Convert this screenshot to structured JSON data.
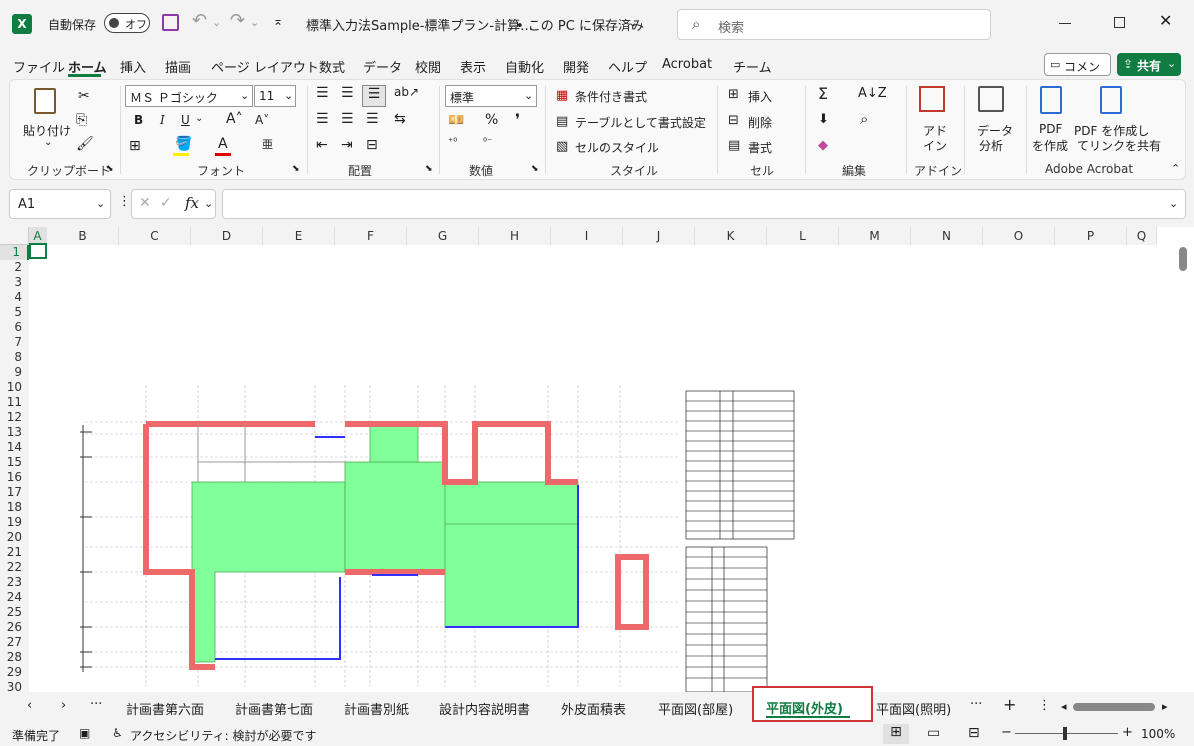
{
  "titlebar": {
    "autosave_label": "自動保存",
    "autosave_state": "オフ",
    "doc_title": "標準入力法Sample-標準プラン-計算…",
    "save_state": "• この PC に保存済み",
    "search_placeholder": "検索"
  },
  "menubar": {
    "items": [
      "ファイル",
      "ホーム",
      "挿入",
      "描画",
      "ページ レイアウト",
      "数式",
      "データ",
      "校閲",
      "表示",
      "自動化",
      "開発",
      "ヘルプ",
      "Acrobat",
      "チーム"
    ],
    "comment_label": "コメント",
    "share_label": "共有"
  },
  "ribbon": {
    "clipboard": {
      "paste": "貼り付け",
      "group": "クリップボード"
    },
    "font": {
      "name": "ＭＳ Ｐゴシック",
      "size": "11",
      "group": "フォント"
    },
    "alignment": {
      "group": "配置"
    },
    "number": {
      "format": "標準",
      "group": "数値"
    },
    "styles": {
      "conditional": "条件付き書式",
      "table": "テーブルとして書式設定",
      "cell": "セルのスタイル",
      "group": "スタイル"
    },
    "cells": {
      "insert": "挿入",
      "delete": "削除",
      "format": "書式",
      "group": "セル"
    },
    "editing": {
      "group": "編集"
    },
    "addins": {
      "label1": "アド",
      "label2": "イン",
      "group": "アドイン"
    },
    "analysis": {
      "label1": "データ",
      "label2": "分析"
    },
    "acrobat": {
      "pdf_create1": "PDF",
      "pdf_create2": "を作成",
      "pdf_share1": "PDF を作成し",
      "pdf_share2": "てリンクを共有",
      "group": "Adobe Acrobat"
    }
  },
  "formula_bar": {
    "name_box": "A1",
    "fx": "fx",
    "value": ""
  },
  "columns": [
    "A",
    "B",
    "C",
    "D",
    "E",
    "F",
    "G",
    "H",
    "I",
    "J",
    "K",
    "L",
    "M",
    "N",
    "O",
    "P",
    "Q"
  ],
  "rows": [
    "1",
    "2",
    "3",
    "4",
    "5",
    "6",
    "7",
    "8",
    "9",
    "10",
    "11",
    "12",
    "13",
    "14",
    "15",
    "16",
    "17",
    "18",
    "19",
    "20",
    "21",
    "22",
    "23",
    "24",
    "25",
    "26",
    "27",
    "28",
    "29",
    "30"
  ],
  "sheet_tabs": [
    "計画書第六面",
    "計画書第七面",
    "計画書別紙",
    "設計内容説明書",
    "外皮面積表",
    "平面図(部屋)",
    "平面図(外皮)",
    "平面図(照明)"
  ],
  "active_tab": "平面図(外皮)",
  "status": {
    "ready": "準備完了",
    "accessibility": "アクセシビリティ: 検討が必要です",
    "zoom": "100%"
  },
  "colors": {
    "accent": "#107c41",
    "highlight": "#d13438",
    "floor": "#80ff9a",
    "wall": "#ee6a6a"
  }
}
